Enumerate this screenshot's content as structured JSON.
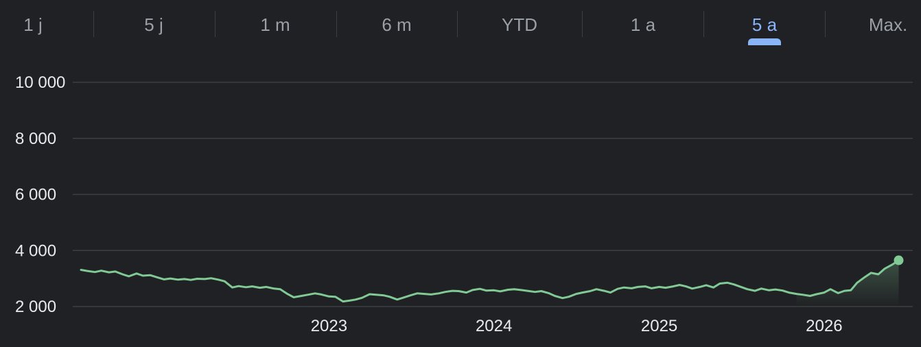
{
  "range_tabs": {
    "items": [
      {
        "label": "1 j",
        "active": false
      },
      {
        "label": "5 j",
        "active": false
      },
      {
        "label": "1 m",
        "active": false
      },
      {
        "label": "6 m",
        "active": false
      },
      {
        "label": "YTD",
        "active": false
      },
      {
        "label": "1 a",
        "active": false
      },
      {
        "label": "5 a",
        "active": true
      },
      {
        "label": "Max.",
        "active": false
      }
    ]
  },
  "colors": {
    "background": "#202124",
    "line": "#81c995",
    "grid": "#3c4043",
    "active_tab": "#8ab4f8",
    "inactive_tab": "#9aa0a6",
    "text": "#e8eaed"
  },
  "chart_data": {
    "type": "line",
    "ylim": [
      2000,
      10000
    ],
    "yticks": [
      {
        "value": 2000,
        "label": "2 000"
      },
      {
        "value": 4000,
        "label": "4 000"
      },
      {
        "value": 6000,
        "label": "6 000"
      },
      {
        "value": 8000,
        "label": "8 000"
      },
      {
        "value": 10000,
        "label": "10 000"
      }
    ],
    "xlim": [
      "2021-07-01",
      "2026-07-01"
    ],
    "xticks": [
      {
        "value": "2023-01-01",
        "label": "2023"
      },
      {
        "value": "2024-01-01",
        "label": "2024"
      },
      {
        "value": "2025-01-01",
        "label": "2025"
      },
      {
        "value": "2026-01-01",
        "label": "2026"
      }
    ],
    "grid": true,
    "series": [
      {
        "points": [
          [
            "2021-07-01",
            3310
          ],
          [
            "2021-07-15",
            3270
          ],
          [
            "2021-08-01",
            3230
          ],
          [
            "2021-08-15",
            3280
          ],
          [
            "2021-09-01",
            3220
          ],
          [
            "2021-09-15",
            3250
          ],
          [
            "2021-10-01",
            3150
          ],
          [
            "2021-10-15",
            3080
          ],
          [
            "2021-11-01",
            3180
          ],
          [
            "2021-11-15",
            3100
          ],
          [
            "2021-12-01",
            3120
          ],
          [
            "2021-12-15",
            3050
          ],
          [
            "2022-01-01",
            2970
          ],
          [
            "2022-01-15",
            3000
          ],
          [
            "2022-02-01",
            2960
          ],
          [
            "2022-02-15",
            2980
          ],
          [
            "2022-03-01",
            2950
          ],
          [
            "2022-03-15",
            2990
          ],
          [
            "2022-04-01",
            2980
          ],
          [
            "2022-04-15",
            3010
          ],
          [
            "2022-05-01",
            2960
          ],
          [
            "2022-05-15",
            2900
          ],
          [
            "2022-06-01",
            2680
          ],
          [
            "2022-06-15",
            2730
          ],
          [
            "2022-07-01",
            2690
          ],
          [
            "2022-07-15",
            2720
          ],
          [
            "2022-08-01",
            2670
          ],
          [
            "2022-08-15",
            2700
          ],
          [
            "2022-09-01",
            2640
          ],
          [
            "2022-09-15",
            2620
          ],
          [
            "2022-10-01",
            2450
          ],
          [
            "2022-10-15",
            2330
          ],
          [
            "2022-11-01",
            2380
          ],
          [
            "2022-11-15",
            2420
          ],
          [
            "2022-12-01",
            2470
          ],
          [
            "2022-12-15",
            2430
          ],
          [
            "2023-01-01",
            2360
          ],
          [
            "2023-01-15",
            2350
          ],
          [
            "2023-02-01",
            2180
          ],
          [
            "2023-02-15",
            2210
          ],
          [
            "2023-03-01",
            2250
          ],
          [
            "2023-03-15",
            2310
          ],
          [
            "2023-04-01",
            2440
          ],
          [
            "2023-04-15",
            2420
          ],
          [
            "2023-05-01",
            2400
          ],
          [
            "2023-05-15",
            2350
          ],
          [
            "2023-06-01",
            2250
          ],
          [
            "2023-06-15",
            2320
          ],
          [
            "2023-07-01",
            2400
          ],
          [
            "2023-07-15",
            2470
          ],
          [
            "2023-08-01",
            2450
          ],
          [
            "2023-08-15",
            2430
          ],
          [
            "2023-09-01",
            2470
          ],
          [
            "2023-09-15",
            2520
          ],
          [
            "2023-10-01",
            2560
          ],
          [
            "2023-10-15",
            2550
          ],
          [
            "2023-11-01",
            2500
          ],
          [
            "2023-11-15",
            2590
          ],
          [
            "2023-12-01",
            2630
          ],
          [
            "2023-12-15",
            2570
          ],
          [
            "2024-01-01",
            2580
          ],
          [
            "2024-01-15",
            2540
          ],
          [
            "2024-02-01",
            2600
          ],
          [
            "2024-02-15",
            2620
          ],
          [
            "2024-03-01",
            2590
          ],
          [
            "2024-03-15",
            2560
          ],
          [
            "2024-04-01",
            2520
          ],
          [
            "2024-04-15",
            2550
          ],
          [
            "2024-05-01",
            2480
          ],
          [
            "2024-05-15",
            2380
          ],
          [
            "2024-06-01",
            2300
          ],
          [
            "2024-06-15",
            2350
          ],
          [
            "2024-07-01",
            2450
          ],
          [
            "2024-07-15",
            2500
          ],
          [
            "2024-08-01",
            2550
          ],
          [
            "2024-08-15",
            2620
          ],
          [
            "2024-09-01",
            2560
          ],
          [
            "2024-09-15",
            2500
          ],
          [
            "2024-10-01",
            2630
          ],
          [
            "2024-10-15",
            2680
          ],
          [
            "2024-11-01",
            2650
          ],
          [
            "2024-11-15",
            2700
          ],
          [
            "2024-12-01",
            2720
          ],
          [
            "2024-12-15",
            2650
          ],
          [
            "2025-01-01",
            2700
          ],
          [
            "2025-01-15",
            2670
          ],
          [
            "2025-02-01",
            2720
          ],
          [
            "2025-02-15",
            2770
          ],
          [
            "2025-03-01",
            2720
          ],
          [
            "2025-03-15",
            2640
          ],
          [
            "2025-04-01",
            2700
          ],
          [
            "2025-04-15",
            2760
          ],
          [
            "2025-05-01",
            2680
          ],
          [
            "2025-05-15",
            2820
          ],
          [
            "2025-06-01",
            2850
          ],
          [
            "2025-06-15",
            2790
          ],
          [
            "2025-07-01",
            2700
          ],
          [
            "2025-07-15",
            2620
          ],
          [
            "2025-08-01",
            2560
          ],
          [
            "2025-08-15",
            2640
          ],
          [
            "2025-09-01",
            2580
          ],
          [
            "2025-09-15",
            2610
          ],
          [
            "2025-10-01",
            2570
          ],
          [
            "2025-10-15",
            2500
          ],
          [
            "2025-11-01",
            2450
          ],
          [
            "2025-11-15",
            2420
          ],
          [
            "2025-12-01",
            2380
          ],
          [
            "2025-12-15",
            2440
          ],
          [
            "2026-01-01",
            2500
          ],
          [
            "2026-01-15",
            2620
          ],
          [
            "2026-02-01",
            2480
          ],
          [
            "2026-02-15",
            2560
          ],
          [
            "2026-03-01",
            2580
          ],
          [
            "2026-03-15",
            2850
          ],
          [
            "2026-04-01",
            3050
          ],
          [
            "2026-04-15",
            3200
          ],
          [
            "2026-05-01",
            3150
          ],
          [
            "2026-05-15",
            3350
          ],
          [
            "2026-06-01",
            3500
          ],
          [
            "2026-06-15",
            3650
          ]
        ]
      }
    ]
  }
}
